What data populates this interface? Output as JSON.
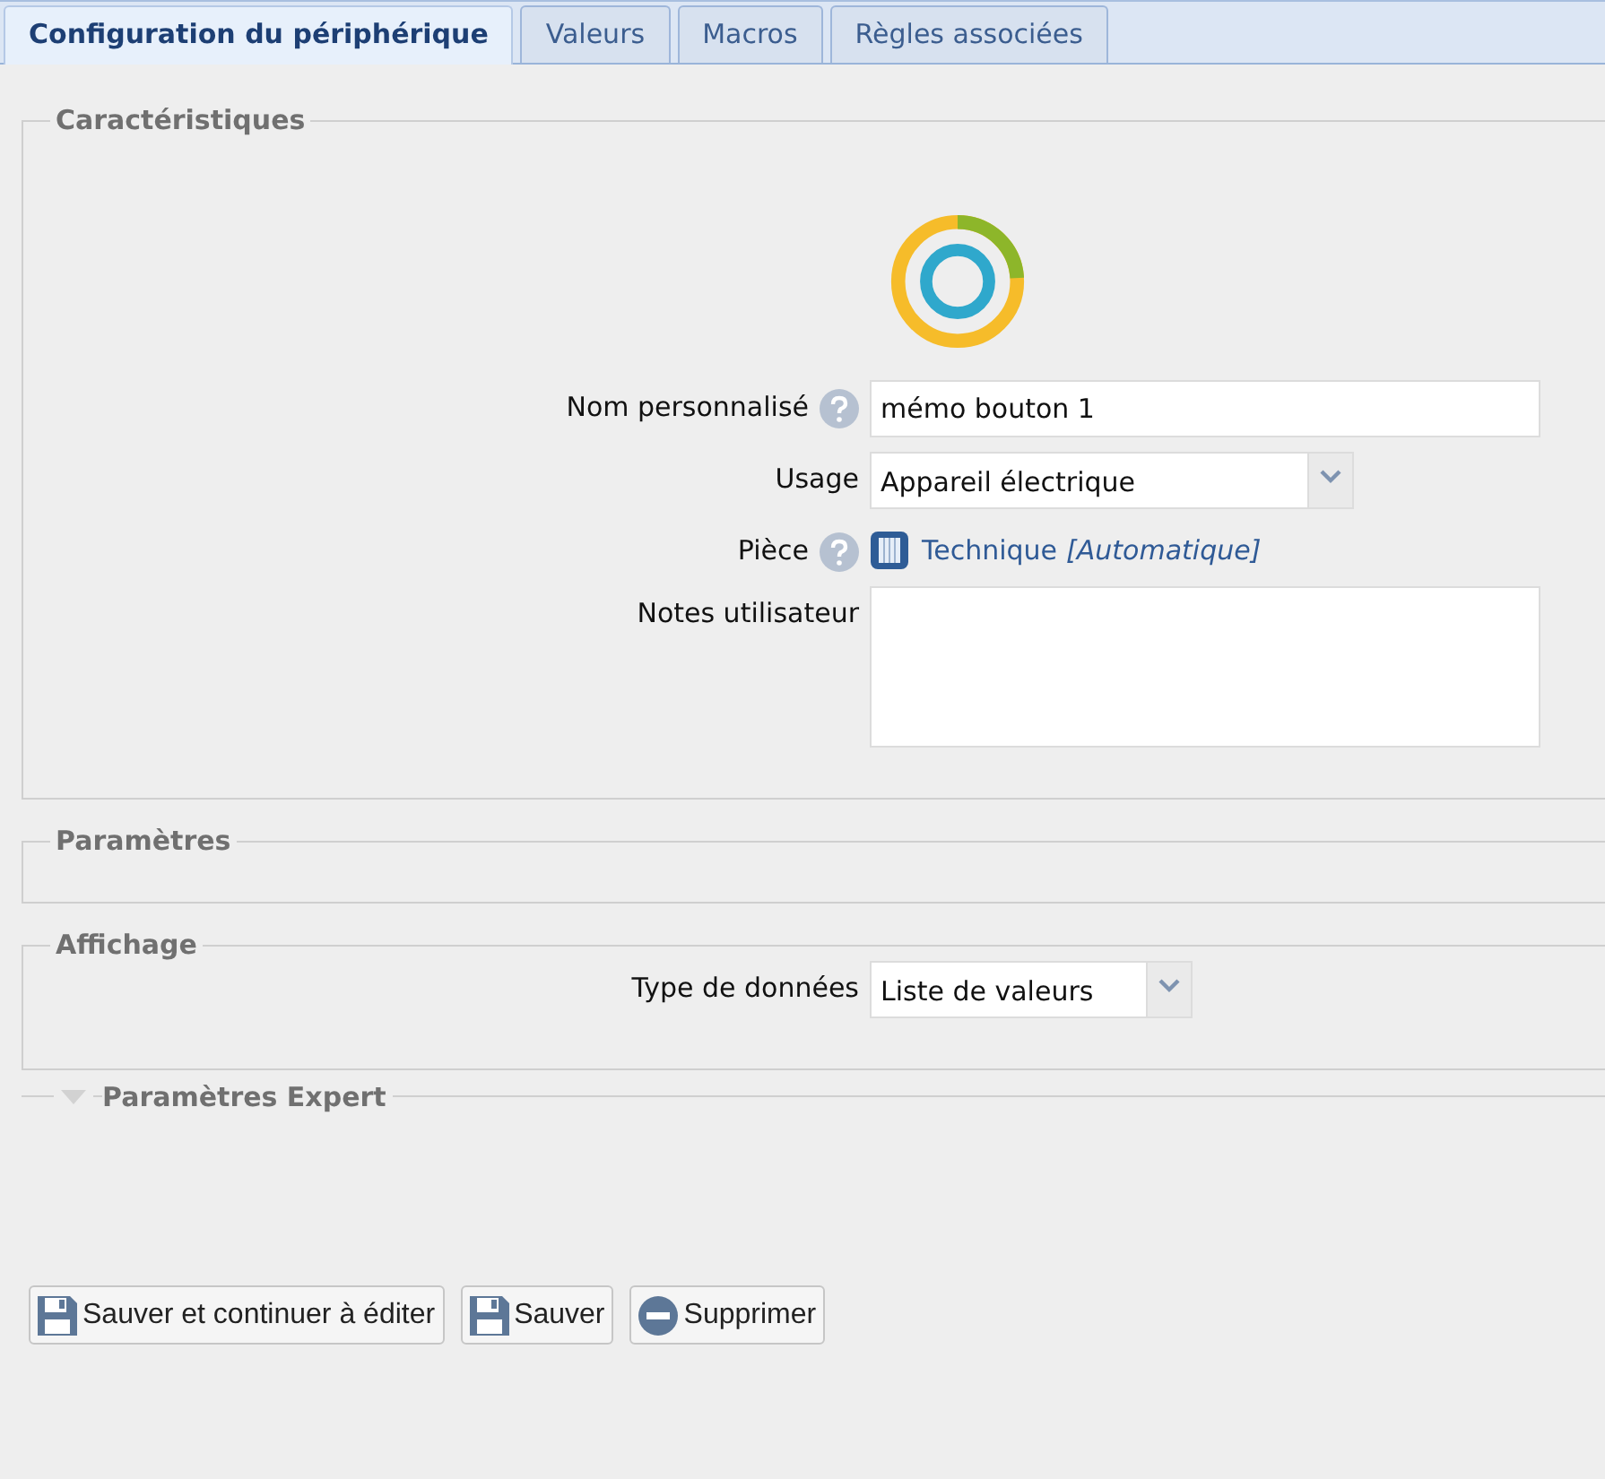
{
  "tabs": [
    {
      "label": "Configuration du périphérique",
      "selected": true
    },
    {
      "label": "Valeurs",
      "selected": false
    },
    {
      "label": "Macros",
      "selected": false
    },
    {
      "label": "Règles associées",
      "selected": false
    }
  ],
  "sections": [
    {
      "title": "Caractéristiques",
      "device_icon": true,
      "fields": [
        {
          "kind": "text",
          "label": "Nom personnalisé",
          "help": true,
          "value": "mémo bouton 1"
        },
        {
          "kind": "select",
          "label": "Usage",
          "value": "Appareil électrique"
        },
        {
          "kind": "link",
          "label": "Pièce",
          "help": true,
          "value": "Technique",
          "note": "[Automatique]"
        },
        {
          "kind": "textarea",
          "label": "Notes utilisateur"
        }
      ]
    },
    {
      "title": "Paramètres"
    },
    {
      "title": "Affichage",
      "fields": [
        {
          "kind": "select",
          "label": "Type de données",
          "value": "Liste de valeurs"
        }
      ]
    }
  ],
  "expert": {
    "title": "Paramètres Expert",
    "expanded": false
  },
  "buttons": [
    {
      "kind": "save",
      "label": "Sauver et continuer à éditer"
    },
    {
      "kind": "save",
      "label": "Sauver"
    },
    {
      "kind": "delete",
      "label": "Supprimer"
    }
  ]
}
